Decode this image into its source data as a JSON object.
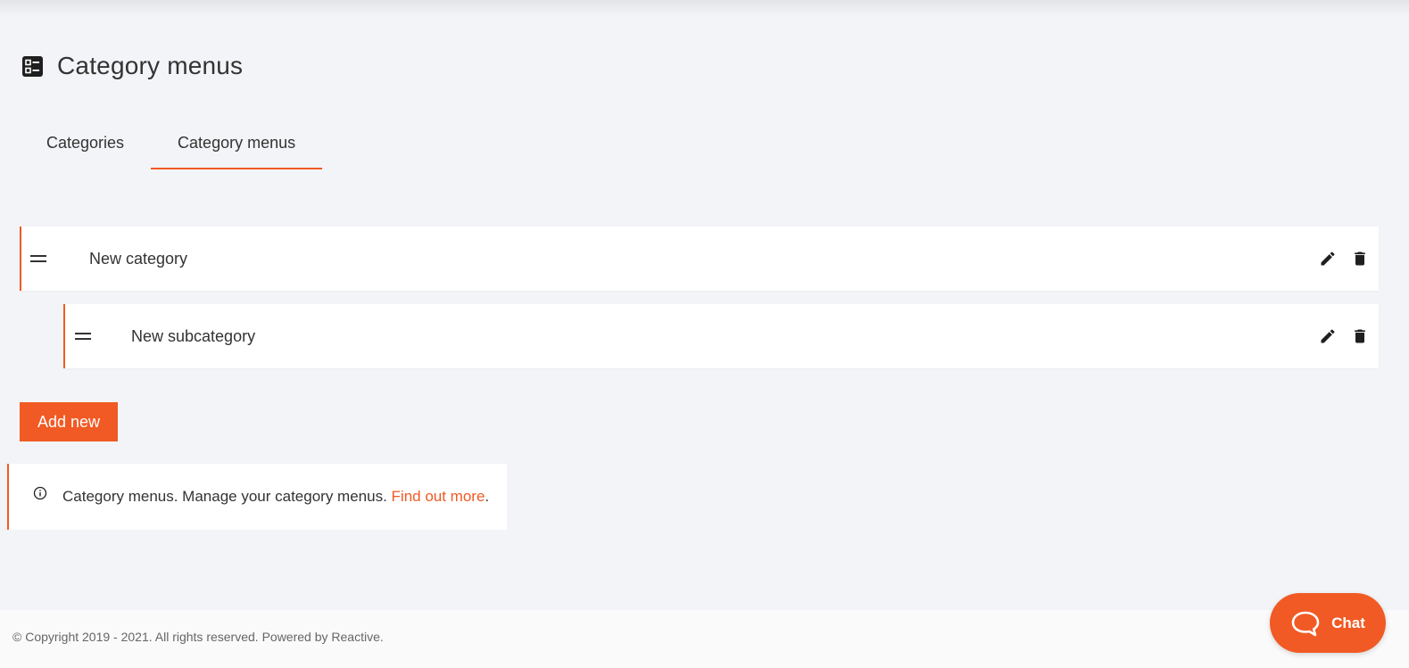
{
  "page": {
    "title": "Category menus",
    "header_icon": "list-icon"
  },
  "tabs": [
    {
      "label": "Categories",
      "active": false
    },
    {
      "label": "Category menus",
      "active": true
    }
  ],
  "menu": {
    "items": [
      {
        "label": "New category",
        "level": 0
      },
      {
        "label": "New subcategory",
        "level": 1
      }
    ]
  },
  "actions": {
    "add_label": "Add new"
  },
  "info": {
    "text": "Category menus. Manage your category menus. ",
    "link_text": "Find out more",
    "suffix": "."
  },
  "footer": {
    "text": "© Copyright 2019 - 2021. All rights reserved. Powered by Reactive."
  },
  "chat": {
    "label": "Chat"
  },
  "colors": {
    "accent": "#f15a24",
    "background": "#f3f4f7"
  }
}
